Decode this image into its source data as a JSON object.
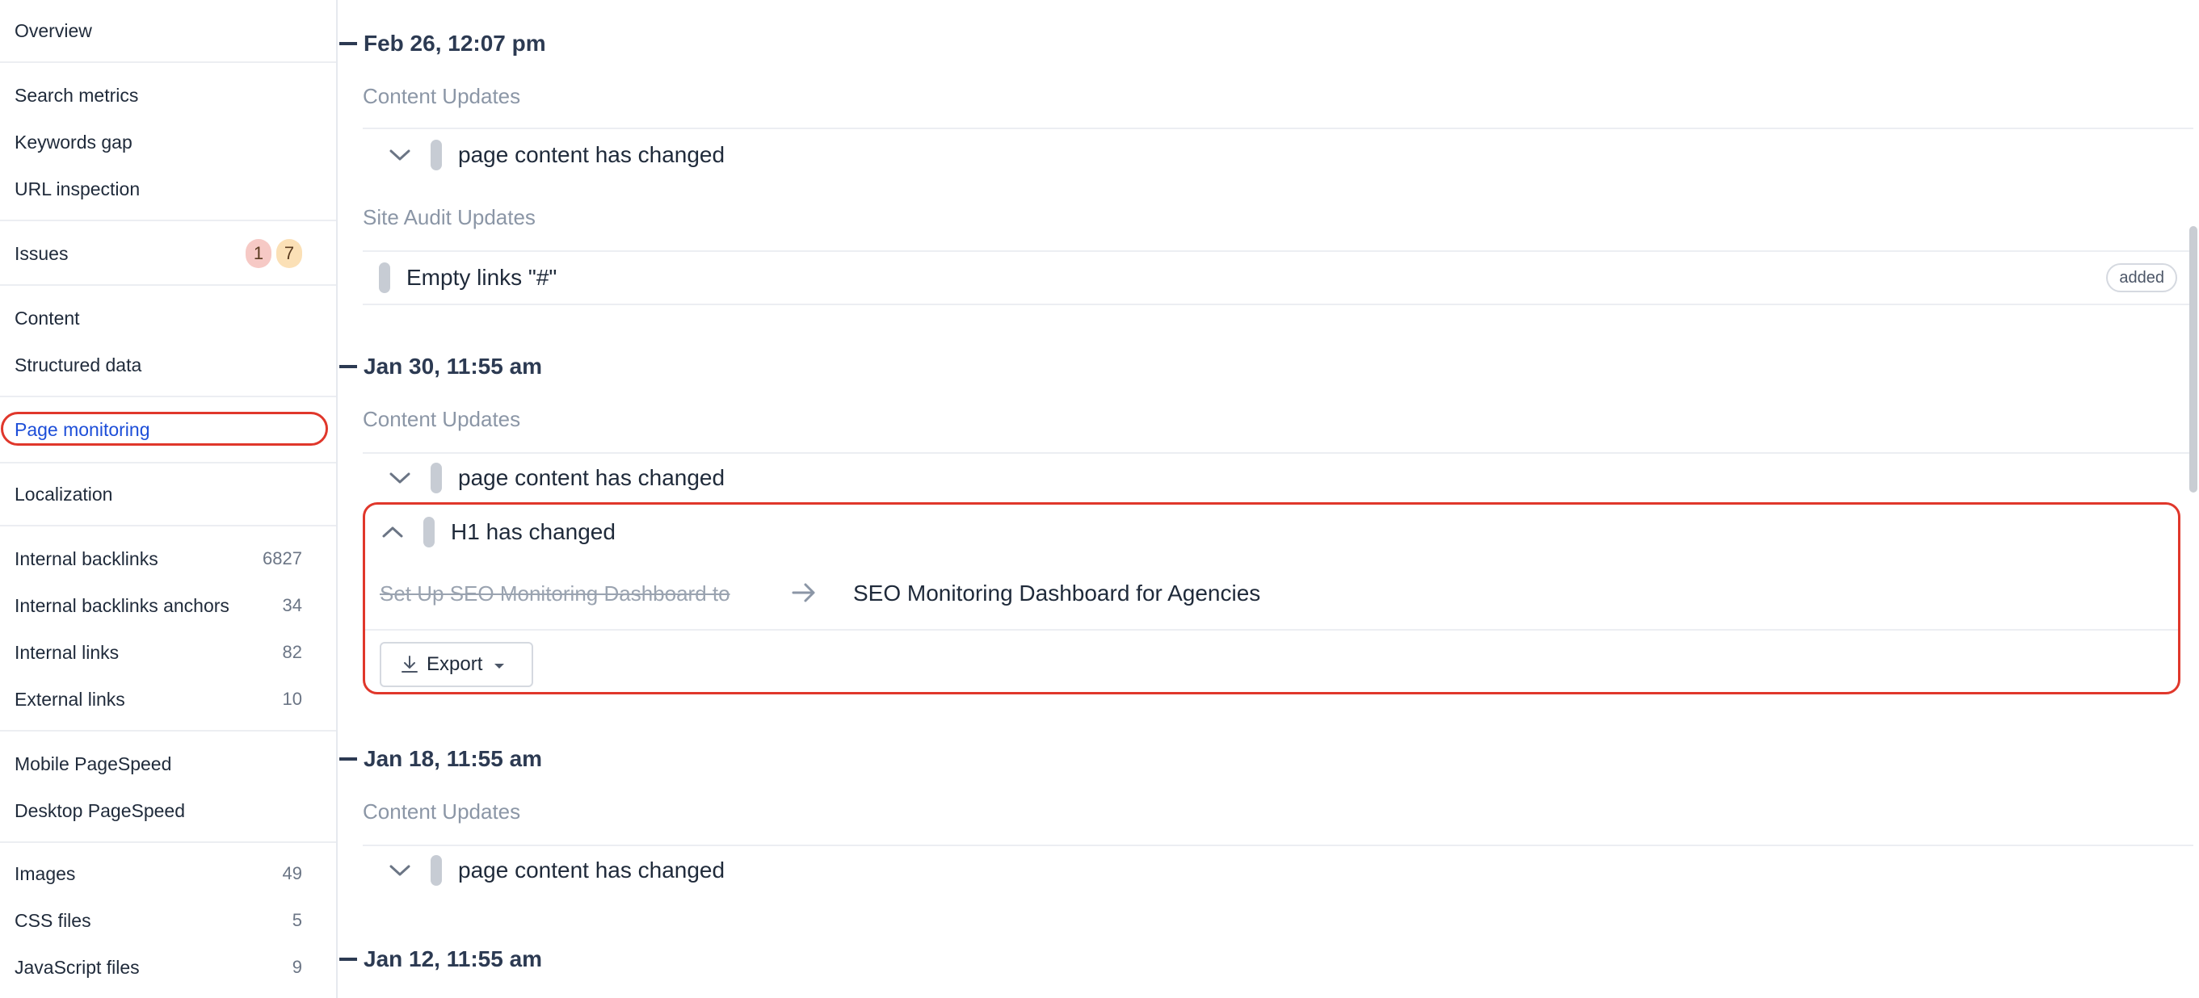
{
  "sidebar": {
    "items": [
      {
        "label": "Overview"
      },
      {
        "label": "Search metrics"
      },
      {
        "label": "Keywords gap"
      },
      {
        "label": "URL inspection"
      },
      {
        "label": "Issues",
        "badges": [
          "1",
          "7"
        ]
      },
      {
        "label": "Content"
      },
      {
        "label": "Structured data"
      },
      {
        "label": "Page monitoring",
        "active": true
      },
      {
        "label": "Localization"
      },
      {
        "label": "Internal backlinks",
        "count": "6827"
      },
      {
        "label": "Internal backlinks anchors",
        "count": "34"
      },
      {
        "label": "Internal links",
        "count": "82"
      },
      {
        "label": "External links",
        "count": "10"
      },
      {
        "label": "Mobile PageSpeed"
      },
      {
        "label": "Desktop PageSpeed"
      },
      {
        "label": "Images",
        "count": "49"
      },
      {
        "label": "CSS files",
        "count": "5"
      },
      {
        "label": "JavaScript files",
        "count": "9"
      }
    ]
  },
  "timeline": {
    "groups": [
      {
        "date": "Feb 26, 12:07 pm",
        "content_title": "Content Updates",
        "content_change": "page content has changed",
        "audit_title": "Site Audit Updates",
        "audit_item": "Empty links \"#\"",
        "audit_tag": "added"
      },
      {
        "date": "Jan 30, 11:55 am",
        "content_title": "Content Updates",
        "content_change": "page content has changed",
        "expanded": {
          "title": "H1 has changed",
          "old_value": "Set Up SEO Monitoring Dashboard to",
          "new_value": "SEO Monitoring Dashboard for Agencies",
          "export_label": "Export"
        }
      },
      {
        "date": "Jan 18, 11:55 am",
        "content_title": "Content Updates",
        "content_change": "page content has changed"
      },
      {
        "date": "Jan 12, 11:55 am"
      }
    ]
  },
  "colors": {
    "highlight": "#e0372b",
    "active_link": "#1d4ed8",
    "date_text": "#2c3a52"
  },
  "icons": {
    "chevron_down": "chevron-down-icon",
    "chevron_up": "chevron-up-icon",
    "arrow_right": "arrow-right-icon",
    "download": "download-icon",
    "caret_down": "caret-down-icon"
  }
}
